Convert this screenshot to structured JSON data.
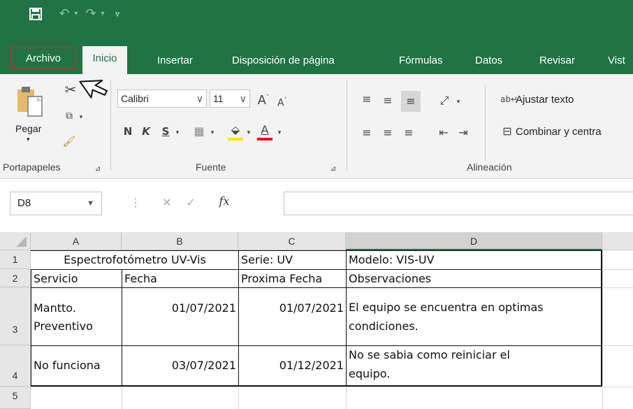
{
  "tabs": [
    "Archivo",
    "Inicio",
    "Insertar",
    "Disposición de página",
    "Fórmulas",
    "Datos",
    "Revisar",
    "Vist"
  ],
  "clipboard": {
    "paste_label": "Pegar",
    "group_label": "Portapapeles"
  },
  "font": {
    "name": "Calibri",
    "size": "11",
    "bold": "N",
    "italic": "K",
    "underline": "S",
    "group_label": "Fuente"
  },
  "alignment": {
    "wrap_text": "Ajustar texto",
    "merge_center": "Combinar y centra",
    "group_label": "Alineación"
  },
  "formula_bar": {
    "name_box": "D8",
    "fx": "fx",
    "value": ""
  },
  "columns": [
    "A",
    "B",
    "C",
    "D"
  ],
  "rows": [
    "1",
    "2",
    "3",
    "4",
    "5"
  ],
  "cells": {
    "r1": {
      "ab": "Espectrofotómetro UV-Vis",
      "c": "Serie: UV",
      "d": "Modelo: VIS-UV"
    },
    "r2": {
      "a": "Servicio",
      "b": "Fecha",
      "c": "Proxima Fecha",
      "d": "Observaciones"
    },
    "r3": {
      "a1": "Mantto.",
      "a2": "Preventivo",
      "b": "01/07/2021",
      "c": "01/07/2021",
      "d1": "El equipo se encuentra en optimas",
      "d2": "condiciones."
    },
    "r4": {
      "a": "No funciona",
      "b": "03/07/2021",
      "c": "01/12/2021",
      "d1": "No se sabia como reiniciar el",
      "d2": "equipo."
    }
  },
  "colors": {
    "accent": "#217346",
    "highlight_border": "#d9202a",
    "font_color": "#e81123",
    "fill_color": "#ffe400"
  }
}
